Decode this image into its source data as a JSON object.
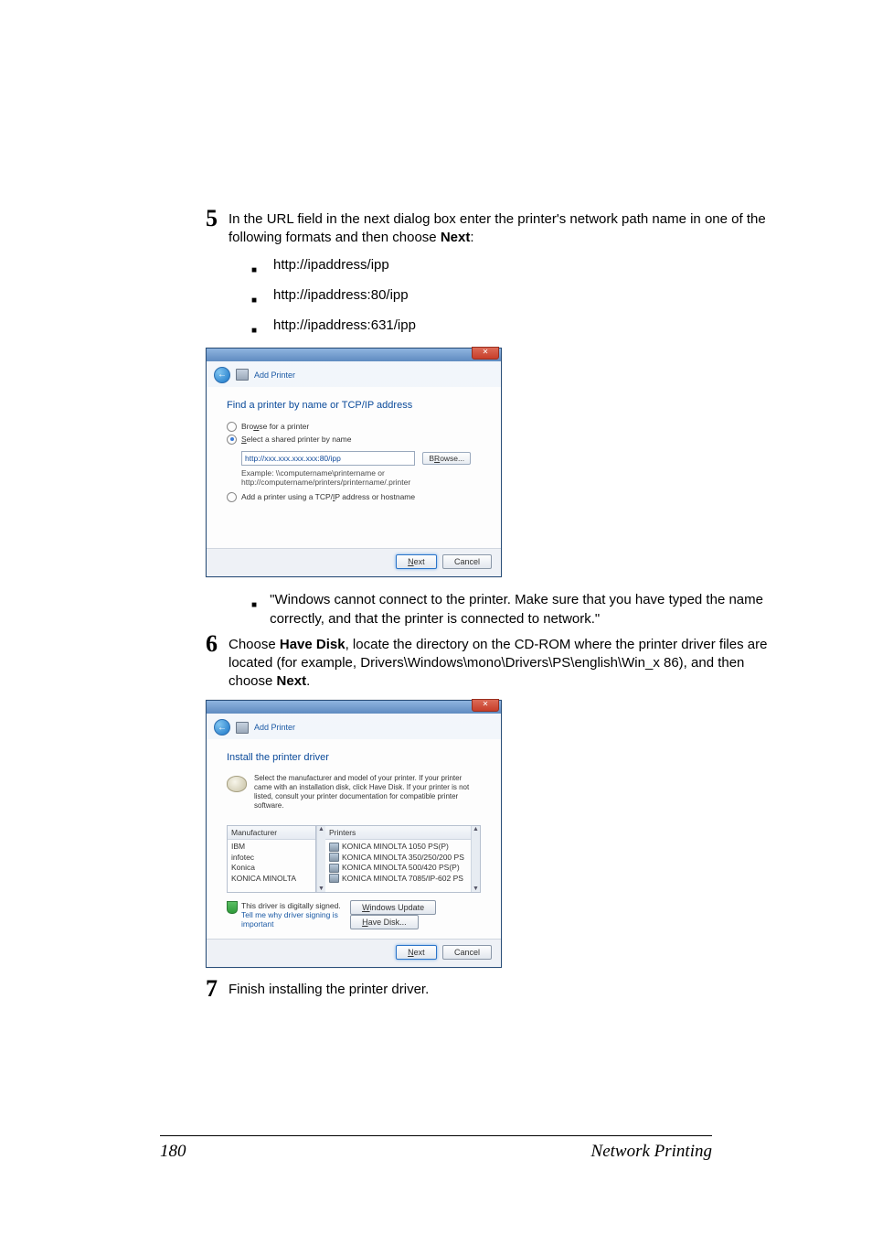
{
  "step5": {
    "num": "5",
    "text_a": "In the URL field in the next dialog box enter the printer's network path name in one of the following formats and then choose ",
    "text_b": "Next",
    "text_c": ":",
    "bullets": [
      "http://ipaddress/ipp",
      "http://ipaddress:80/ipp",
      "http://ipaddress:631/ipp"
    ],
    "note": "\"Windows cannot connect to the printer. Make sure that you have typed the name correctly, and that the printer is connected to network.\""
  },
  "dialog1": {
    "title": "Add Printer",
    "heading": "Find a printer by name or TCP/IP address",
    "opt_browse": "Browse for a printer",
    "opt_browse_ul": "w",
    "opt_select": "Select a shared printer by name",
    "opt_select_ul": "S",
    "url_value": "http://xxx.xxx.xxx.xxx:80/ipp",
    "browse_btn": "Browse...",
    "browse_ul": "R",
    "example1": "Example: \\\\computername\\printername or",
    "example2": "http://computername/printers/printername/.printer",
    "opt_tcpip": "Add a printer using a TCP/IP address or hostname",
    "opt_tcpip_ul": "I",
    "next": "Next",
    "next_ul": "N",
    "cancel": "Cancel"
  },
  "step6": {
    "num": "6",
    "a": "Choose ",
    "b": "Have Disk",
    "c": ", locate the directory on the CD-ROM where the printer driver files are located (for example, Drivers\\Windows\\mono\\Drivers\\PS\\english\\Win_x 86), and then choose ",
    "d": "Next",
    "e": "."
  },
  "dialog2": {
    "title": "Add Printer",
    "heading": "Install the printer driver",
    "instr": "Select the manufacturer and model of your printer. If your printer came with an installation disk, click Have Disk. If your printer is not listed, consult your printer documentation for compatible printer software.",
    "col_m": "Manufacturer",
    "col_p": "Printers",
    "manufacturers": [
      "IBM",
      "infotec",
      "Konica",
      "KONICA MINOLTA"
    ],
    "printers": [
      "KONICA MINOLTA 1050 PS(P)",
      "KONICA MINOLTA 350/250/200 PS",
      "KONICA MINOLTA 500/420 PS(P)",
      "KONICA MINOLTA 7085/IP-602 PS"
    ],
    "signed": "This driver is digitally signed.",
    "tell": "Tell me why driver signing is important",
    "win_update": "Windows Update",
    "win_update_ul": "W",
    "have_disk": "Have Disk...",
    "have_disk_ul": "H",
    "next": "Next",
    "next_ul": "N",
    "cancel": "Cancel"
  },
  "step7": {
    "num": "7",
    "text": "Finish installing the printer driver."
  },
  "footer": {
    "page": "180",
    "section": "Network Printing"
  }
}
